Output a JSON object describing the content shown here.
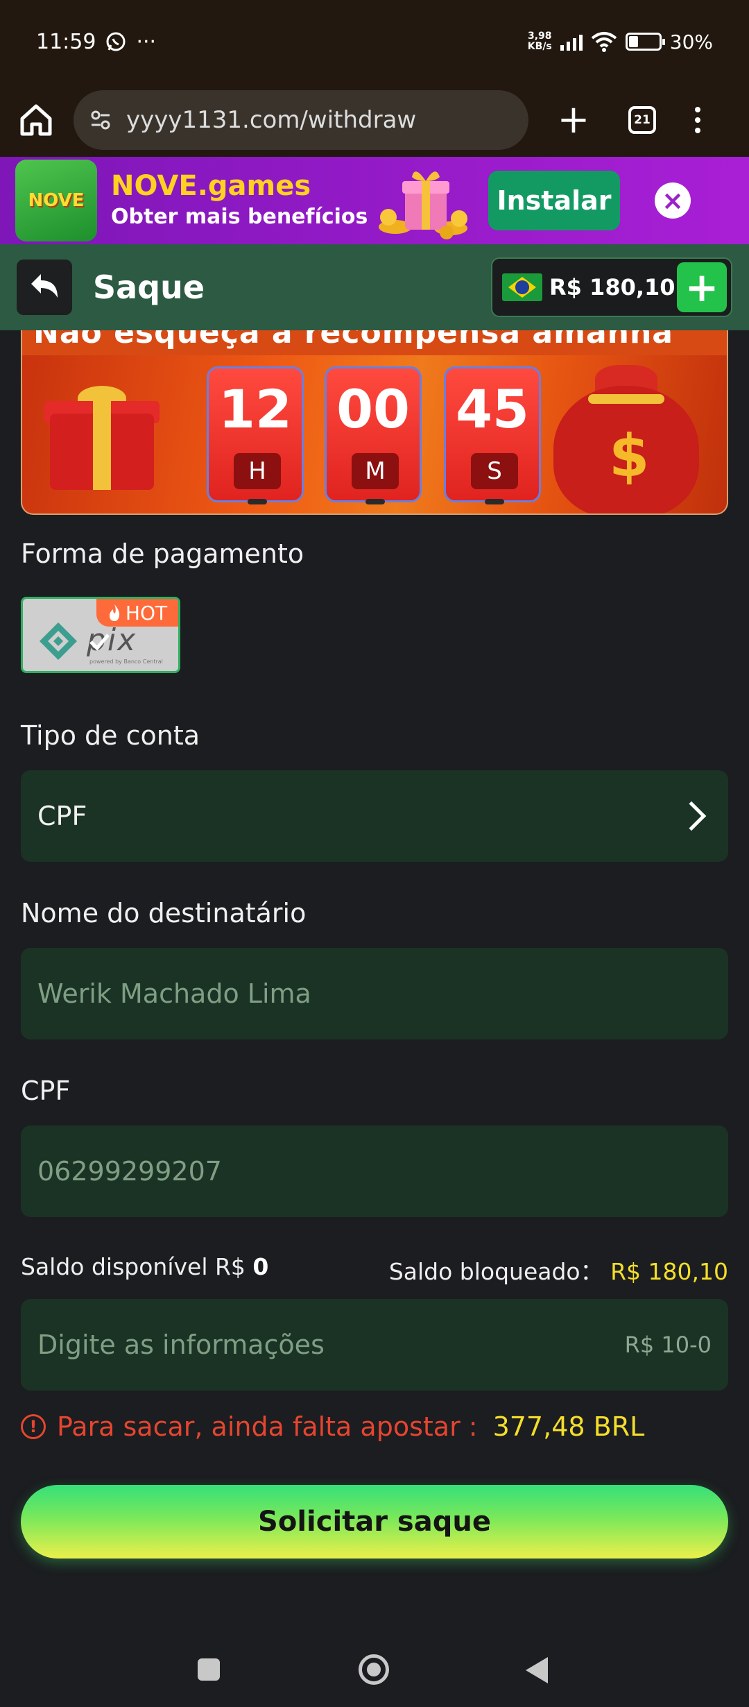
{
  "status_bar": {
    "time": "11:59",
    "net_speed_value": "3,98",
    "net_speed_unit": "KB/s",
    "battery": "30%",
    "battery_level": 0.3,
    "notification_icons": [
      "whatsapp-icon",
      "more-dots-icon"
    ]
  },
  "browser": {
    "url": "yyyy1131.com/withdraw",
    "tab_count": "21"
  },
  "install_banner": {
    "app_name": "NOVE.games",
    "subtitle": "Obter mais benefícios",
    "install_label": "Instalar",
    "icon_text": "NOVE"
  },
  "header": {
    "title": "Saque",
    "balance": "R$ 180,10"
  },
  "promo": {
    "strip_text": "Não esqueça a recompensa amanhã",
    "timer": [
      {
        "value": "12",
        "unit": "H"
      },
      {
        "value": "00",
        "unit": "M"
      },
      {
        "value": "45",
        "unit": "S"
      }
    ]
  },
  "form": {
    "payment_label": "Forma de pagamento",
    "payment_option": {
      "name": "pix",
      "badge": "HOT",
      "subtext": "powered by Banco Central"
    },
    "account_type_label": "Tipo de conta",
    "account_type_value": "CPF",
    "recipient_label": "Nome do destinatário",
    "recipient_value": "Werik Machado Lima",
    "cpf_label": "CPF",
    "cpf_value": "06299299207",
    "available_label": "Saldo disponível R$",
    "available_value": "0",
    "blocked_label": "Saldo bloqueado：",
    "blocked_value": "R$ 180,10",
    "amount_placeholder": "Digite as informações",
    "amount_range": "R$ 10-0",
    "warning_text": "Para sacar, ainda falta apostar :",
    "warning_amount": "377,48 BRL",
    "submit_label": "Solicitar saque"
  },
  "colors": {
    "background": "#1b1d20",
    "header_green": "#2c5a43",
    "field_green": "#1b3325",
    "accent_yellow": "#f5de2a",
    "warning_red": "#e6452f",
    "banner_purple": "#a91fd6"
  }
}
